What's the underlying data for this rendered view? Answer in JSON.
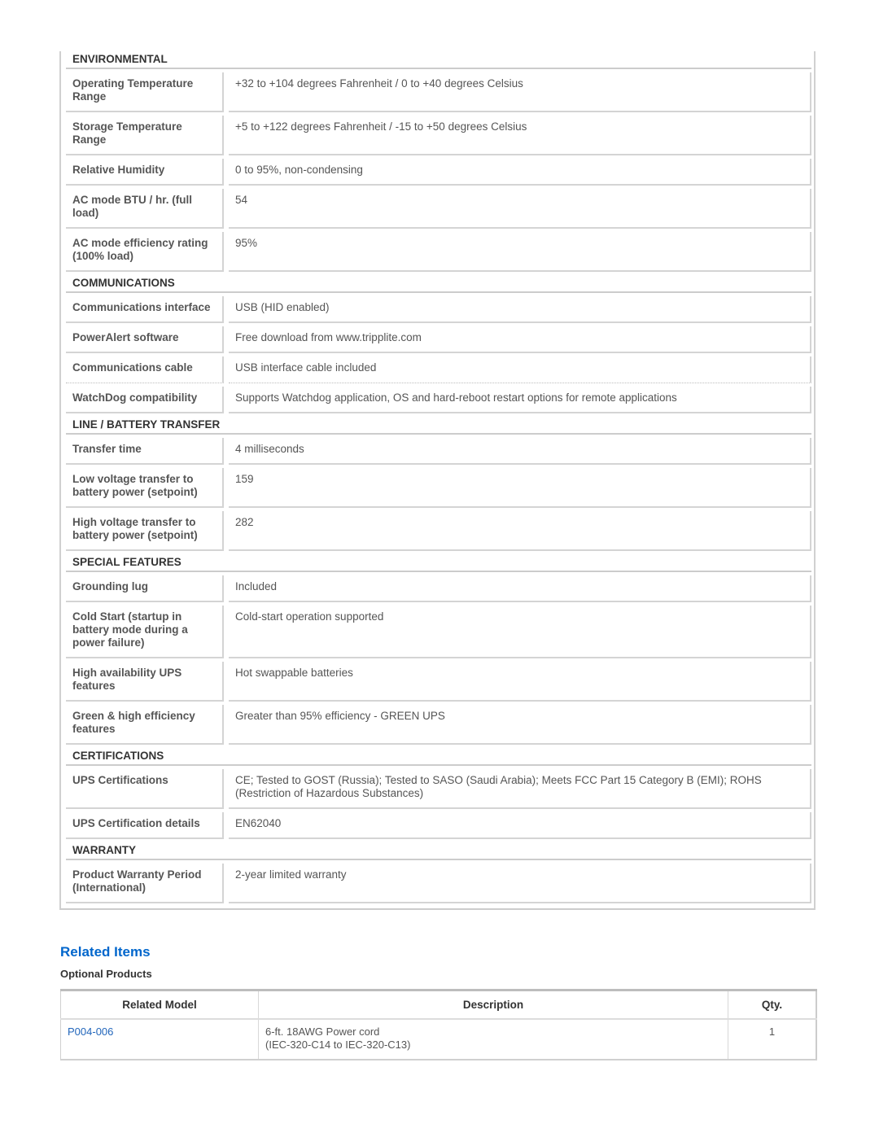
{
  "specs": {
    "sections": [
      {
        "title": "ENVIRONMENTAL",
        "rows": [
          {
            "label": "Operating Temperature Range",
            "value": "+32 to +104 degrees Fahrenheit / 0 to +40 degrees Celsius"
          },
          {
            "label": "Storage Temperature Range",
            "value": "+5 to +122 degrees Fahrenheit / -15 to +50 degrees Celsius"
          },
          {
            "label": "Relative Humidity",
            "value": "0 to 95%, non-condensing"
          },
          {
            "label": "AC mode BTU / hr. (full load)",
            "value": "54"
          },
          {
            "label": "AC mode efficiency rating (100% load)",
            "value": "95%"
          }
        ]
      },
      {
        "title": "COMMUNICATIONS",
        "rows": [
          {
            "label": "Communications interface",
            "value": "USB (HID enabled)"
          },
          {
            "label": "PowerAlert software",
            "value": "Free download from www.tripplite.com"
          },
          {
            "label": "Communications cable",
            "value": "USB interface cable included"
          },
          {
            "label": "WatchDog compatibility",
            "value": "Supports Watchdog application, OS and hard-reboot restart options for remote applications"
          }
        ]
      },
      {
        "title": "LINE / BATTERY TRANSFER",
        "rows": [
          {
            "label": "Transfer time",
            "value": "4 milliseconds"
          },
          {
            "label": "Low voltage transfer to battery power (setpoint)",
            "value": "159"
          },
          {
            "label": "High voltage transfer to battery power (setpoint)",
            "value": "282"
          }
        ]
      },
      {
        "title": "SPECIAL FEATURES",
        "rows": [
          {
            "label": "Grounding lug",
            "value": "Included"
          },
          {
            "label": "Cold Start (startup in battery mode during a power failure)",
            "value": "Cold-start operation supported"
          },
          {
            "label": "High availability UPS features",
            "value": "Hot swappable batteries"
          },
          {
            "label": "Green & high efficiency features",
            "value": "Greater than 95% efficiency - GREEN UPS"
          }
        ]
      },
      {
        "title": "CERTIFICATIONS",
        "rows": [
          {
            "label": "UPS Certifications",
            "value": "CE; Tested to GOST (Russia); Tested to SASO (Saudi Arabia); Meets FCC Part 15 Category B (EMI); ROHS (Restriction of Hazardous Substances)"
          },
          {
            "label": "UPS Certification details",
            "value": "EN62040"
          }
        ]
      },
      {
        "title": "WARRANTY",
        "rows": [
          {
            "label": "Product Warranty Period (International)",
            "value": "2-year limited warranty"
          }
        ]
      }
    ]
  },
  "related": {
    "title": "Related Items",
    "subtitle": "Optional Products",
    "columns": [
      "Related Model",
      "Description",
      "Qty."
    ],
    "rows": [
      {
        "model": "P004-006",
        "description_line1": "6-ft. 18AWG Power cord",
        "description_line2": "(IEC-320-C14 to IEC-320-C13)",
        "qty": "1"
      }
    ]
  },
  "colors": {
    "link": "#2266bb",
    "heading_blue": "#0066cc",
    "border": "#d4d4d4"
  }
}
